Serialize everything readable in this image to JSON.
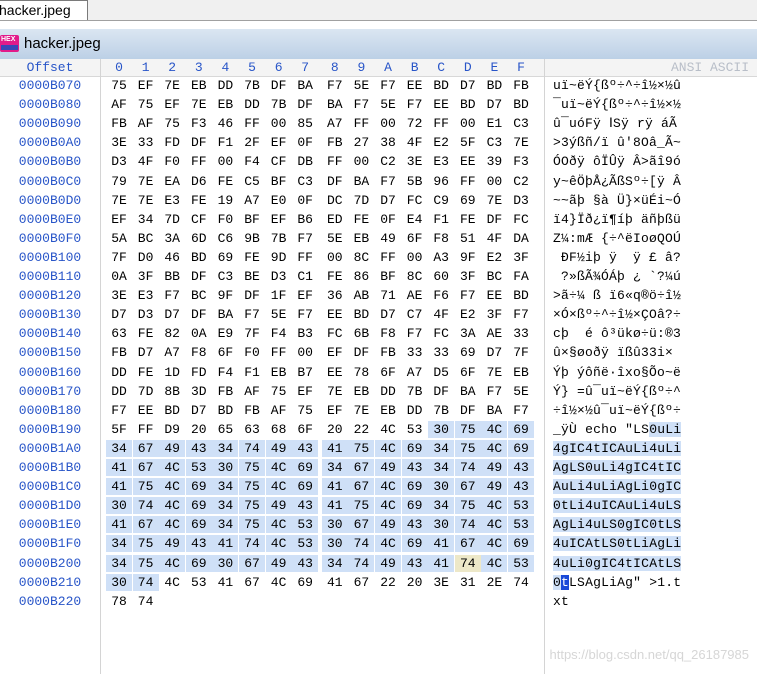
{
  "tab": {
    "label": "hacker.jpeg"
  },
  "window": {
    "title": "hacker.jpeg",
    "logo_text": "HEX"
  },
  "header": {
    "offset_label": "Offset",
    "columns": [
      "0",
      "1",
      "2",
      "3",
      "4",
      "5",
      "6",
      "7",
      "8",
      "9",
      "A",
      "B",
      "C",
      "D",
      "E",
      "F"
    ],
    "ansi_label": "ANSI ASCII"
  },
  "selection": {
    "start": "B19C",
    "end": "B211",
    "cursor": "B211",
    "cursor_char": "g",
    "highlight": "B20D"
  },
  "rows": [
    {
      "offset": "0000B070",
      "bytes": [
        "75",
        "EF",
        "7E",
        "EB",
        "DD",
        "7B",
        "DF",
        "BA",
        "F7",
        "5E",
        "F7",
        "EE",
        "BD",
        "D7",
        "BD",
        "FB"
      ],
      "ascii": "uï~ëÝ{ßº÷^÷î½×½û"
    },
    {
      "offset": "0000B080",
      "bytes": [
        "AF",
        "75",
        "EF",
        "7E",
        "EB",
        "DD",
        "7B",
        "DF",
        "BA",
        "F7",
        "5E",
        "F7",
        "EE",
        "BD",
        "D7",
        "BD"
      ],
      "ascii": "¯uï~ëÝ{ßº÷^÷î½×½"
    },
    {
      "offset": "0000B090",
      "bytes": [
        "FB",
        "AF",
        "75",
        "F3",
        "46",
        "FF",
        "00",
        "85",
        "A7",
        "FF",
        "00",
        "72",
        "FF",
        "00",
        "E1",
        "C3"
      ],
      "ascii": "û¯uóFÿ ⅠSÿ rÿ áÃ"
    },
    {
      "offset": "0000B0A0",
      "bytes": [
        "3E",
        "33",
        "FD",
        "DF",
        "F1",
        "2F",
        "EF",
        "0F",
        "FB",
        "27",
        "38",
        "4F",
        "E2",
        "5F",
        "C3",
        "7E"
      ],
      "ascii": ">3ýßñ/ï û'8Oâ_Ã~"
    },
    {
      "offset": "0000B0B0",
      "bytes": [
        "D3",
        "4F",
        "F0",
        "FF",
        "00",
        "F4",
        "CF",
        "DB",
        "FF",
        "00",
        "C2",
        "3E",
        "E3",
        "EE",
        "39",
        "F3"
      ],
      "ascii": "ÓOðÿ ôÏÛÿ Â>ãî9ó"
    },
    {
      "offset": "0000B0C0",
      "bytes": [
        "79",
        "7E",
        "EA",
        "D6",
        "FE",
        "C5",
        "BF",
        "C3",
        "DF",
        "BA",
        "F7",
        "5B",
        "96",
        "FF",
        "00",
        "C2"
      ],
      "ascii": "y~êÖþÅ¿ÃßSº÷[ÿ Â"
    },
    {
      "offset": "0000B0D0",
      "bytes": [
        "7E",
        "7E",
        "E3",
        "FE",
        "19",
        "A7",
        "E0",
        "0F",
        "DC",
        "7D",
        "D7",
        "FC",
        "C9",
        "69",
        "7E",
        "D3"
      ],
      "ascii": "~~ãþ §à Ü}×üÉi~Ó"
    },
    {
      "offset": "0000B0E0",
      "bytes": [
        "EF",
        "34",
        "7D",
        "CF",
        "F0",
        "BF",
        "EF",
        "B6",
        "ED",
        "FE",
        "0F",
        "E4",
        "F1",
        "FE",
        "DF",
        "FC"
      ],
      "ascii": "ï4}Ïð¿ï¶íþ äñþßü"
    },
    {
      "offset": "0000B0F0",
      "bytes": [
        "5A",
        "BC",
        "3A",
        "6D",
        "C6",
        "9B",
        "7B",
        "F7",
        "5E",
        "EB",
        "49",
        "6F",
        "F8",
        "51",
        "4F",
        "DA"
      ],
      "ascii": "Z¼:mÆ {÷^ëIoøQOÚ"
    },
    {
      "offset": "0000B100",
      "bytes": [
        "7F",
        "D0",
        "46",
        "BD",
        "69",
        "FE",
        "9D",
        "FF",
        "00",
        "8C",
        "FF",
        "00",
        "A3",
        "9F",
        "E2",
        "3F"
      ],
      "ascii": " ÐF½iþ ÿ  ÿ £ â?"
    },
    {
      "offset": "0000B110",
      "bytes": [
        "0A",
        "3F",
        "BB",
        "DF",
        "C3",
        "BE",
        "D3",
        "C1",
        "FE",
        "86",
        "BF",
        "8C",
        "60",
        "3F",
        "BC",
        "FA"
      ],
      "ascii": " ?»ßÃ¾ÓÁþ ¿ `?¼ú"
    },
    {
      "offset": "0000B120",
      "bytes": [
        "3E",
        "E3",
        "F7",
        "BC",
        "9F",
        "DF",
        "1F",
        "EF",
        "36",
        "AB",
        "71",
        "AE",
        "F6",
        "F7",
        "EE",
        "BD"
      ],
      "ascii": ">ã÷¼ ß ï6«q®ö÷î½"
    },
    {
      "offset": "0000B130",
      "bytes": [
        "D7",
        "D3",
        "D7",
        "DF",
        "BA",
        "F7",
        "5E",
        "F7",
        "EE",
        "BD",
        "D7",
        "C7",
        "4F",
        "E2",
        "3F",
        "F7"
      ],
      "ascii": "×Ó×ßº÷^÷î½×ÇOâ?÷"
    },
    {
      "offset": "0000B140",
      "bytes": [
        "63",
        "FE",
        "82",
        "0A",
        "E9",
        "7F",
        "F4",
        "B3",
        "FC",
        "6B",
        "F8",
        "F7",
        "FC",
        "3A",
        "AE",
        "33"
      ],
      "ascii": "cþ  é ô³ükø÷ü:®3"
    },
    {
      "offset": "0000B150",
      "bytes": [
        "FB",
        "D7",
        "A7",
        "F8",
        "6F",
        "F0",
        "FF",
        "00",
        "EF",
        "DF",
        "FB",
        "33",
        "33",
        "69",
        "D7",
        "7F"
      ],
      "ascii": "û×§øoðÿ ïßû33i× "
    },
    {
      "offset": "0000B160",
      "bytes": [
        "DD",
        "FE",
        "1D",
        "FD",
        "F4",
        "F1",
        "EB",
        "B7",
        "EE",
        "78",
        "6F",
        "A7",
        "D5",
        "6F",
        "7E",
        "EB"
      ],
      "ascii": "Ýþ ýôñë·îxo§Õo~ë"
    },
    {
      "offset": "0000B170",
      "bytes": [
        "DD",
        "7D",
        "8B",
        "3D",
        "FB",
        "AF",
        "75",
        "EF",
        "7E",
        "EB",
        "DD",
        "7B",
        "DF",
        "BA",
        "F7",
        "5E"
      ],
      "ascii": "Ý} =û¯uï~ëÝ{ßº÷^"
    },
    {
      "offset": "0000B180",
      "bytes": [
        "F7",
        "EE",
        "BD",
        "D7",
        "BD",
        "FB",
        "AF",
        "75",
        "EF",
        "7E",
        "EB",
        "DD",
        "7B",
        "DF",
        "BA",
        "F7"
      ],
      "ascii": "÷î½×½û¯uï~ëÝ{ßº÷"
    },
    {
      "offset": "0000B190",
      "bytes": [
        "5F",
        "FF",
        "D9",
        "20",
        "65",
        "63",
        "68",
        "6F",
        "20",
        "22",
        "4C",
        "53",
        "30",
        "75",
        "4C",
        "69"
      ],
      "ascii": "_ÿÙ echo \"LS0uLi"
    },
    {
      "offset": "0000B1A0",
      "bytes": [
        "34",
        "67",
        "49",
        "43",
        "34",
        "74",
        "49",
        "43",
        "41",
        "75",
        "4C",
        "69",
        "34",
        "75",
        "4C",
        "69"
      ],
      "ascii": "4gIC4tICAuLi4uLi"
    },
    {
      "offset": "0000B1B0",
      "bytes": [
        "41",
        "67",
        "4C",
        "53",
        "30",
        "75",
        "4C",
        "69",
        "34",
        "67",
        "49",
        "43",
        "34",
        "74",
        "49",
        "43"
      ],
      "ascii": "AgLS0uLi4gIC4tIC"
    },
    {
      "offset": "0000B1C0",
      "bytes": [
        "41",
        "75",
        "4C",
        "69",
        "34",
        "75",
        "4C",
        "69",
        "41",
        "67",
        "4C",
        "69",
        "30",
        "67",
        "49",
        "43"
      ],
      "ascii": "AuLi4uLiAgLi0gIC"
    },
    {
      "offset": "0000B1D0",
      "bytes": [
        "30",
        "74",
        "4C",
        "69",
        "34",
        "75",
        "49",
        "43",
        "41",
        "75",
        "4C",
        "69",
        "34",
        "75",
        "4C",
        "53"
      ],
      "ascii": "0tLi4uICAuLi4uLS"
    },
    {
      "offset": "0000B1E0",
      "bytes": [
        "41",
        "67",
        "4C",
        "69",
        "34",
        "75",
        "4C",
        "53",
        "30",
        "67",
        "49",
        "43",
        "30",
        "74",
        "4C",
        "53"
      ],
      "ascii": "AgLi4uLS0gIC0tLS"
    },
    {
      "offset": "0000B1F0",
      "bytes": [
        "34",
        "75",
        "49",
        "43",
        "41",
        "74",
        "4C",
        "53",
        "30",
        "74",
        "4C",
        "69",
        "41",
        "67",
        "4C",
        "69"
      ],
      "ascii": "4uICAtLS0tLiAgLi"
    },
    {
      "offset": "0000B200",
      "bytes": [
        "34",
        "75",
        "4C",
        "69",
        "30",
        "67",
        "49",
        "43",
        "34",
        "74",
        "49",
        "43",
        "41",
        "74",
        "4C",
        "53"
      ],
      "ascii": "4uLi0gIC4tICAtLS"
    },
    {
      "offset": "0000B210",
      "bytes": [
        "30",
        "74",
        "4C",
        "53",
        "41",
        "67",
        "4C",
        "69",
        "41",
        "67",
        "22",
        "20",
        "3E",
        "31",
        "2E",
        "74"
      ],
      "ascii": "0tLSAgLiAg\" >1.t"
    },
    {
      "offset": "0000B220",
      "bytes": [
        "78",
        "74"
      ],
      "ascii": "xt"
    }
  ],
  "watermark": "https://blog.csdn.net/qq_26187985"
}
